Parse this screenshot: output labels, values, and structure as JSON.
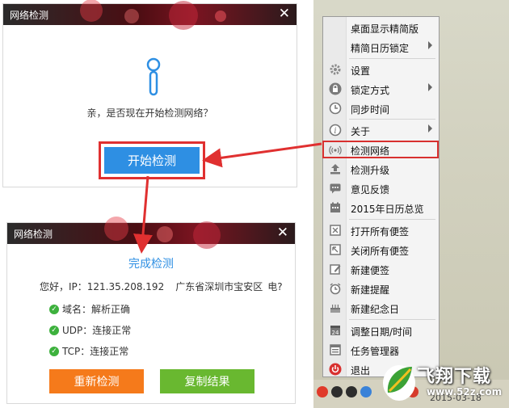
{
  "dialog1": {
    "title": "网络检测",
    "close": "✕",
    "question": "亲，是否现在开始检测网络？",
    "start_button": "开始检测"
  },
  "dialog2": {
    "title": "网络检测",
    "close": "✕",
    "heading": "完成检测",
    "ip_line": {
      "greeting": "您好，IP：121.35.208.192",
      "location": "广东省深圳市宝安区",
      "isp": "电?"
    },
    "statuses": [
      {
        "label": "域名：解析正确"
      },
      {
        "label": "UDP：连接正常"
      },
      {
        "label": "TCP：连接正常"
      }
    ],
    "retest_button": "重新检测",
    "copy_button": "复制结果"
  },
  "menu": {
    "items": [
      {
        "label": "桌面显示精简版",
        "icon": "none",
        "submenu": false
      },
      {
        "label": "精简日历锁定",
        "icon": "none",
        "submenu": true
      },
      {
        "label": "设置",
        "icon": "gear-icon",
        "submenu": false
      },
      {
        "label": "锁定方式",
        "icon": "lock-icon",
        "submenu": true
      },
      {
        "label": "同步时间",
        "icon": "clock-icon",
        "submenu": false
      },
      {
        "label": "关于",
        "icon": "info-icon",
        "submenu": true
      },
      {
        "label": "检测网络",
        "icon": "signal-icon",
        "submenu": false
      },
      {
        "label": "检测升级",
        "icon": "upload-icon",
        "submenu": false
      },
      {
        "label": "意见反馈",
        "icon": "chat-icon",
        "submenu": false
      },
      {
        "label": "2015年日历总览",
        "icon": "calendar-icon",
        "submenu": false
      },
      {
        "label": "打开所有便签",
        "icon": "note-open-icon",
        "submenu": false
      },
      {
        "label": "关闭所有便签",
        "icon": "note-close-icon",
        "submenu": false
      },
      {
        "label": "新建便签",
        "icon": "note-edit-icon",
        "submenu": false
      },
      {
        "label": "新建提醒",
        "icon": "alarm-icon",
        "submenu": false
      },
      {
        "label": "新建纪念日",
        "icon": "cake-icon",
        "submenu": false
      },
      {
        "label": "调整日期/时间",
        "icon": "date-icon",
        "submenu": false
      },
      {
        "label": "任务管理器",
        "icon": "task-icon",
        "submenu": false
      },
      {
        "label": "退出",
        "icon": "power-icon",
        "submenu": false
      }
    ]
  },
  "taskbar": {
    "clock": "2015-03-18"
  },
  "watermark": {
    "brand": "飞翔下载",
    "url": "www.52z.com"
  },
  "colors": {
    "accent_blue": "#2e8fe3",
    "highlight_red": "#e03030",
    "retest_orange": "#f57a1b",
    "copy_green": "#69b830",
    "ok_green": "#3db13d"
  }
}
